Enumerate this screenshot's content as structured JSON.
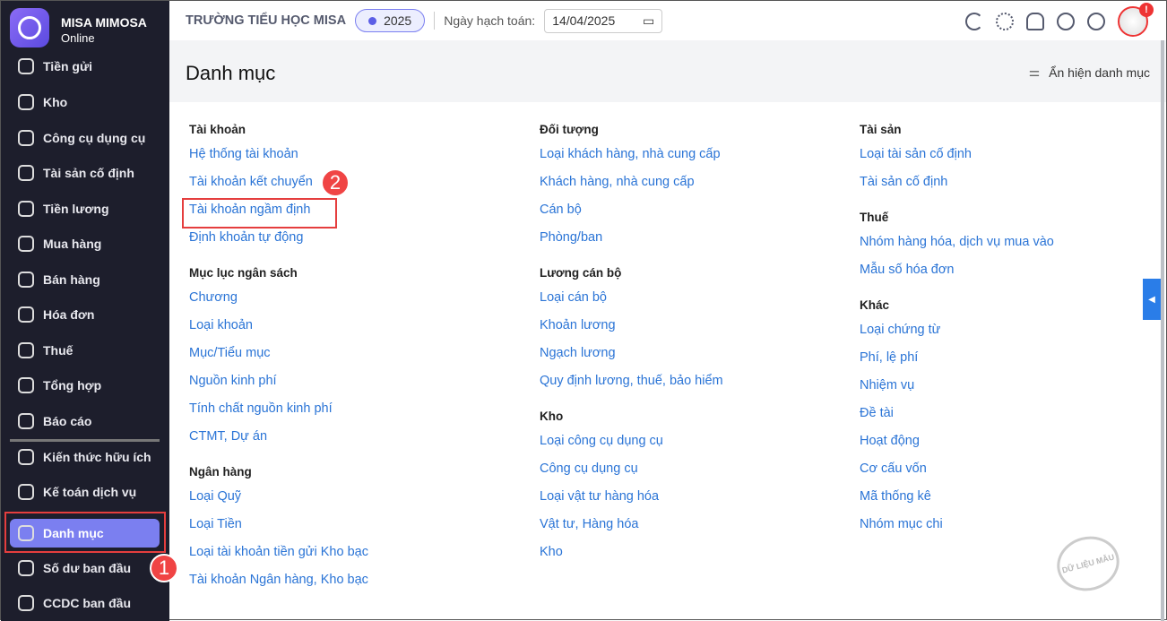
{
  "brand": {
    "name": "MISA MIMOSA",
    "sub": "Online"
  },
  "sidebar": {
    "items": [
      {
        "label": "Tiền gửi",
        "icon": "dollar-arrow-icon"
      },
      {
        "label": "Kho",
        "icon": "warehouse-icon"
      },
      {
        "label": "Công cụ dụng cụ",
        "icon": "tools-icon"
      },
      {
        "label": "Tài sản cố định",
        "icon": "truck-icon"
      },
      {
        "label": "Tiền lương",
        "icon": "wallet-icon"
      },
      {
        "label": "Mua hàng",
        "icon": "cart-icon"
      },
      {
        "label": "Bán hàng",
        "icon": "store-icon"
      },
      {
        "label": "Hóa đơn",
        "icon": "invoice-icon"
      },
      {
        "label": "Thuế",
        "icon": "tax-icon"
      },
      {
        "label": "Tổng hợp",
        "icon": "summary-icon"
      },
      {
        "label": "Báo cáo",
        "icon": "report-icon"
      },
      {
        "label": "Kiến thức hữu ích",
        "icon": "book-icon"
      },
      {
        "label": "Kế toán dịch vụ",
        "icon": "service-icon"
      },
      {
        "label": "Danh mục",
        "icon": "list-icon",
        "active": true
      },
      {
        "label": "Số dư ban đầu",
        "icon": "balance-icon"
      },
      {
        "label": "CCDC ban đầu",
        "icon": "devices-icon"
      }
    ]
  },
  "header": {
    "school": "TRƯỜNG TIỂU HỌC MISA",
    "year": "2025",
    "date_label": "Ngày hạch toán:",
    "date": "14/04/2025",
    "notification_badge": "!"
  },
  "page": {
    "title": "Danh mục",
    "toggle_label": "Ẩn hiện danh mục"
  },
  "callouts": [
    "1",
    "2"
  ],
  "columns": [
    [
      {
        "title": "Tài khoản",
        "links": [
          "Hệ thống tài khoản",
          "Tài khoản kết chuyển",
          "Tài khoản ngầm định",
          "Định khoản tự động"
        ]
      },
      {
        "title": "Mục lục ngân sách",
        "links": [
          "Chương",
          "Loại khoản",
          "Mục/Tiểu mục",
          "Nguồn kinh phí",
          "Tính chất nguồn kinh phí",
          "CTMT, Dự án"
        ]
      },
      {
        "title": "Ngân hàng",
        "links": [
          "Loại Quỹ",
          "Loại Tiền",
          "Loại tài khoản tiền gửi Kho bạc",
          "Tài khoản Ngân hàng, Kho bạc"
        ]
      }
    ],
    [
      {
        "title": "Đối tượng",
        "links": [
          "Loại khách hàng, nhà cung cấp",
          "Khách hàng, nhà cung cấp",
          "Cán bộ",
          "Phòng/ban"
        ]
      },
      {
        "title": "Lương cán bộ",
        "links": [
          "Loại cán bộ",
          "Khoản lương",
          "Ngạch lương",
          "Quy định lương, thuế, bảo hiểm"
        ]
      },
      {
        "title": "Kho",
        "links": [
          "Loại công cụ dụng cụ",
          "Công cụ dụng cụ",
          "Loại vật tư hàng hóa",
          "Vật tư, Hàng hóa",
          "Kho"
        ]
      }
    ],
    [
      {
        "title": "Tài sản",
        "links": [
          "Loại tài sản cố định",
          "Tài sản cố định"
        ]
      },
      {
        "title": "Thuế",
        "links": [
          "Nhóm hàng hóa, dịch vụ mua vào",
          "Mẫu số hóa đơn"
        ]
      },
      {
        "title": "Khác",
        "links": [
          "Loại chứng từ",
          "Phí, lệ phí",
          "Nhiệm vụ",
          "Đề tài",
          "Hoạt động",
          "Cơ cấu vốn",
          "Mã thống kê",
          "Nhóm mục chi"
        ]
      }
    ]
  ],
  "watermark": "DỮ LIỆU MẪU",
  "colors": {
    "accent": "#7b7ff0",
    "link": "#2a74d6",
    "sidebar": "#1d1e2c",
    "callout": "#f04444"
  }
}
